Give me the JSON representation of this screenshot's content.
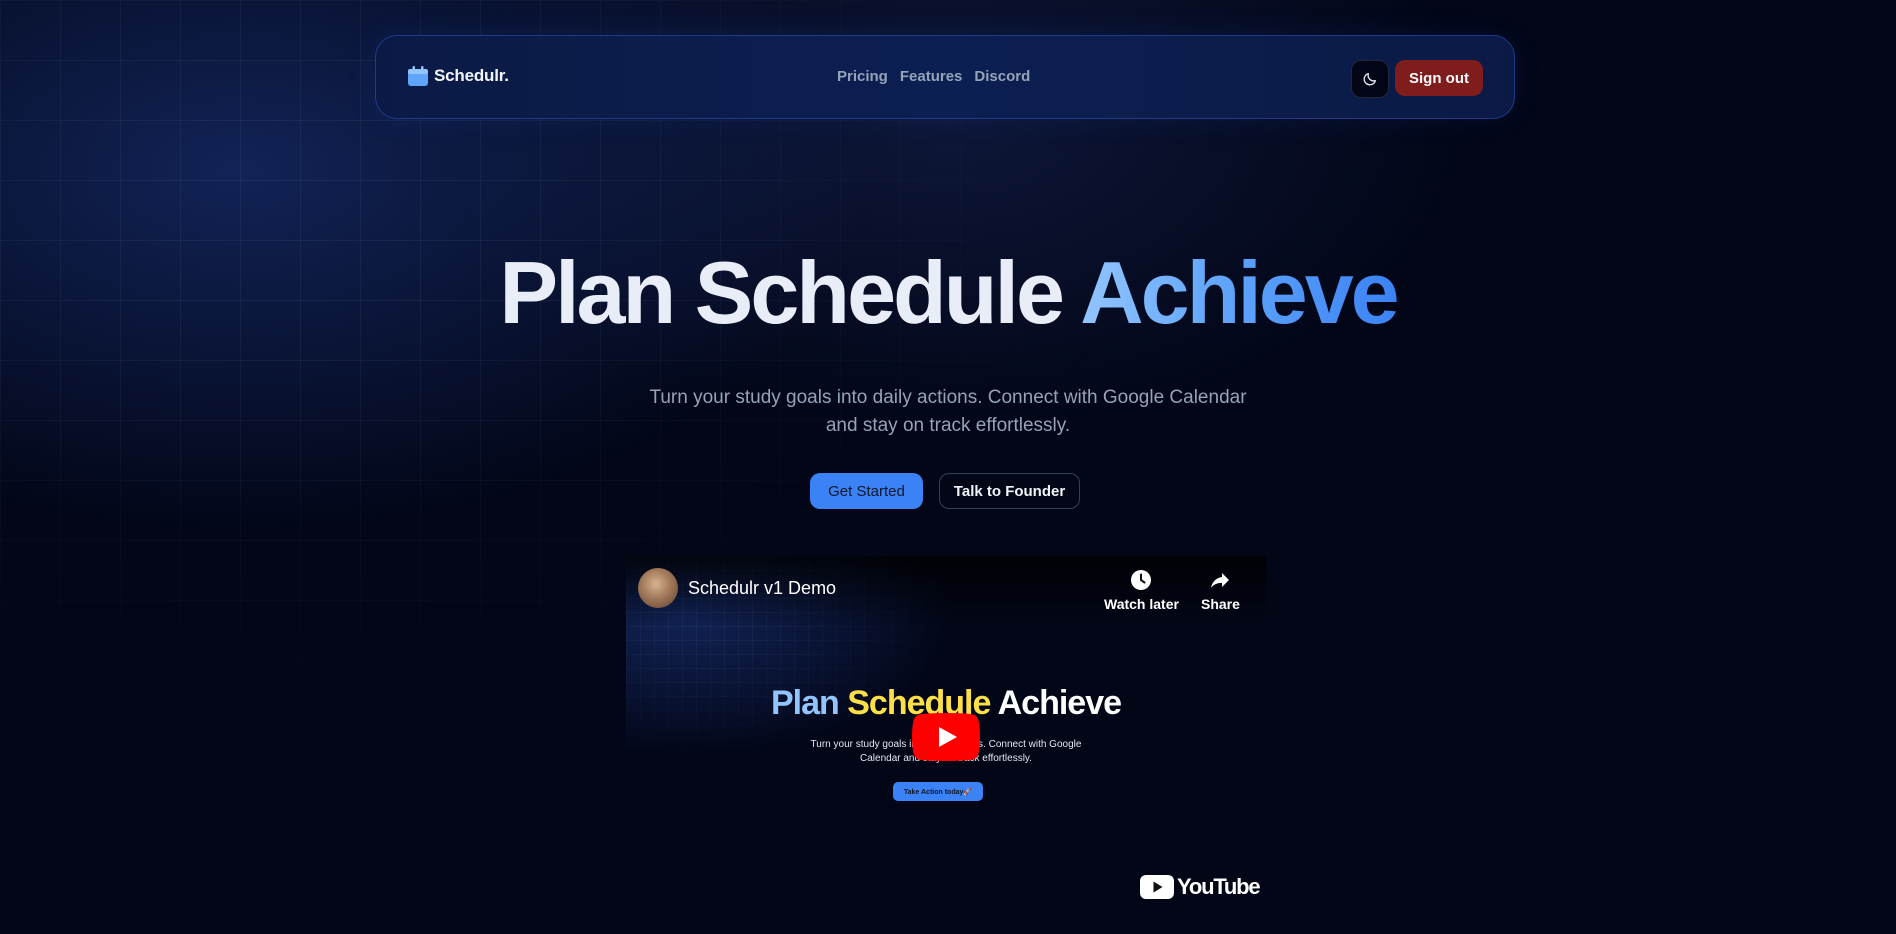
{
  "colors": {
    "background": "#020617",
    "navbar": "#0b1a45",
    "accent": "#3b82f6",
    "signout": "#7f1d1d",
    "youtube_red": "#ff0000"
  },
  "navbar": {
    "brand": "Schedulr.",
    "brand_icon": "calendar-icon",
    "links": [
      "Pricing",
      "Features",
      "Discord"
    ],
    "theme_toggle_icon": "moon-icon",
    "signout_label": "Sign out"
  },
  "hero": {
    "title_parts": [
      "Plan",
      "Schedule",
      "Achieve"
    ],
    "subtitle": "Turn your study goals into daily actions. Connect with Google Calendar and stay on track effortlessly.",
    "primary_cta": "Get Started",
    "secondary_cta": "Talk to Founder"
  },
  "video": {
    "title": "Schedulr v1 Demo",
    "watch_later": "Watch later",
    "share": "Share",
    "inner_title_parts": [
      "Plan",
      "Schedule",
      "Achieve"
    ],
    "inner_subtitle": "Turn your study goals into daily actions. Connect with Google Calendar and stay on track effortlessly.",
    "inner_button": "Take Action today🚀",
    "brand": "YouTube"
  }
}
